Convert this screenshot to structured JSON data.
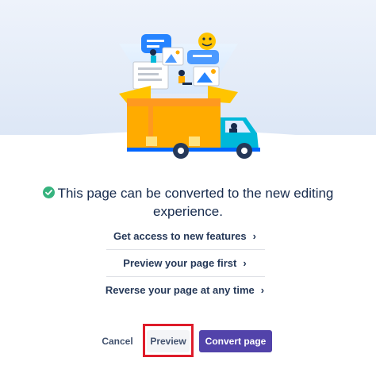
{
  "dialog": {
    "headline_line1": "This page can be converted to the new editing",
    "headline_line2": "experience.",
    "status_icon": "check-circle-icon",
    "status_color": "#36b37e"
  },
  "features": [
    {
      "label": "Get access to new features"
    },
    {
      "label": "Preview your page first"
    },
    {
      "label": "Reverse your page at any time"
    }
  ],
  "chevron_glyph": "›",
  "actions": {
    "cancel_label": "Cancel",
    "preview_label": "Preview",
    "convert_label": "Convert page"
  },
  "colors": {
    "accent": "#5243aa",
    "highlight": "#de1c2a",
    "box": "#ffab00",
    "truck": "#00b8d9"
  }
}
